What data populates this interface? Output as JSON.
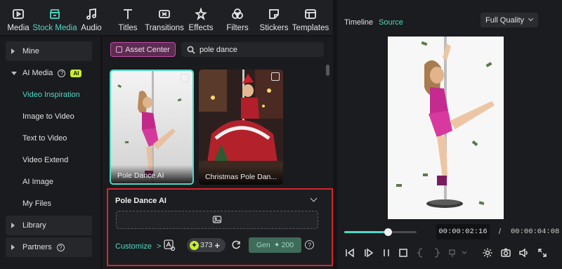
{
  "toolbar": {
    "items": [
      {
        "label": "Media",
        "icon": "media-icon"
      },
      {
        "label": "Stock Media",
        "icon": "stock-media-icon",
        "active": true
      },
      {
        "label": "Audio",
        "icon": "music-note-icon"
      },
      {
        "label": "Titles",
        "icon": "titles-t-icon"
      },
      {
        "label": "Transitions",
        "icon": "transitions-icon"
      },
      {
        "label": "Effects",
        "icon": "effects-sparkle-icon"
      },
      {
        "label": "Filters",
        "icon": "filters-icon"
      },
      {
        "label": "Stickers",
        "icon": "stickers-icon"
      },
      {
        "label": "Templates",
        "icon": "templates-icon"
      }
    ]
  },
  "sidebar": {
    "mine": "Mine",
    "ai_media": "AI Media",
    "ai_badge": "AI",
    "sub_items": [
      "Video Inspiration",
      "Image to Video",
      "Text to Video",
      "Video Extend",
      "AI Image",
      "My Files"
    ],
    "library": "Library",
    "partners": "Partners",
    "help_glyph": "?"
  },
  "content": {
    "asset_center": "Asset Center",
    "search_value": "pole dance",
    "thumbnails": [
      {
        "caption": "Pole Dance AI",
        "selected": true
      },
      {
        "caption": "Christmas Pole Dan..."
      }
    ]
  },
  "detail": {
    "title": "Pole Dance AI",
    "customize": "Customize",
    "customize_arrow": ">",
    "credits": "373",
    "credits_plus": "+",
    "generate_label": "Gen",
    "generate_cost": "200",
    "help_glyph": "?"
  },
  "preview": {
    "tabs": {
      "timeline": "Timeline",
      "source": "Source"
    },
    "quality": "Full Quality",
    "current_time": "00:00:02:16",
    "separator": "/",
    "total_time": "00:00:04:08",
    "progress": 0.6
  },
  "colors": {
    "accent": "#4fd9c3",
    "ai_badge": "#c8ef2d",
    "highlight_border": "#d3262b",
    "asset_center_bg": "#5b2d52"
  }
}
